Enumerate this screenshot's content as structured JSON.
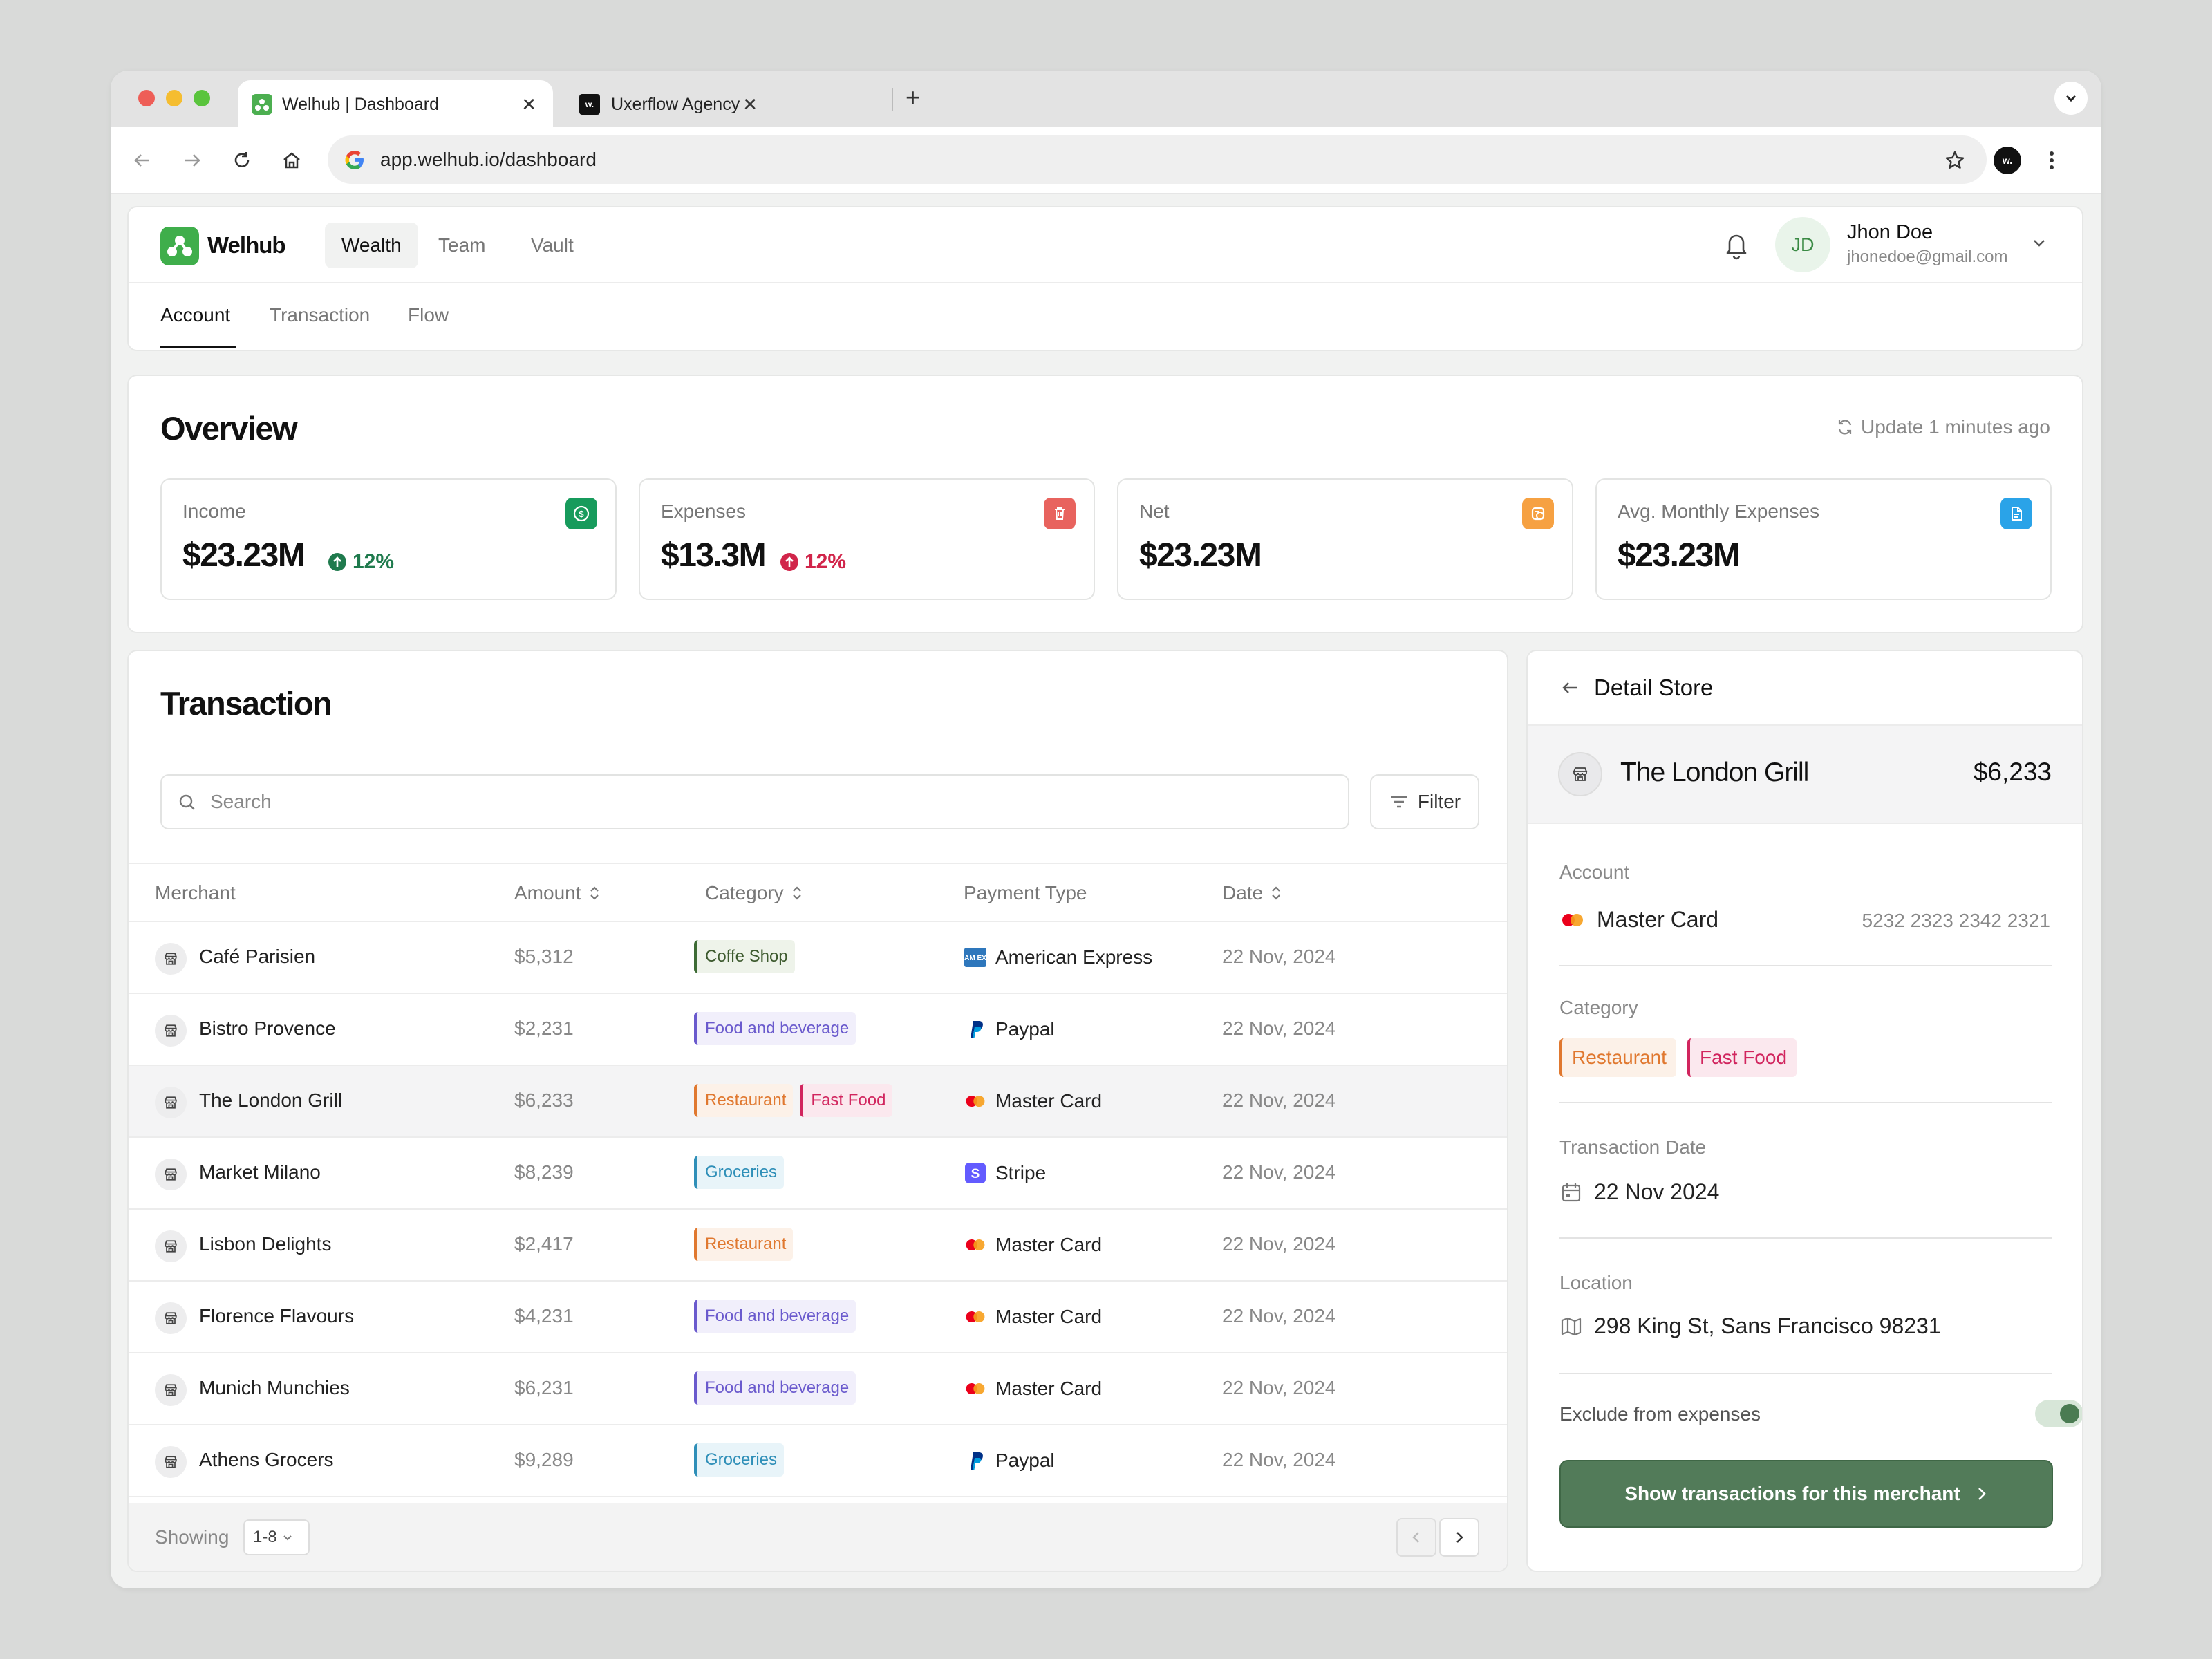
{
  "browser": {
    "tabs": [
      {
        "title": "Welhub | Dashboard",
        "close": "✕"
      },
      {
        "title": "Uxerflow Agency",
        "close": "✕"
      }
    ],
    "new_tab": "+",
    "url": "app.welhub.io/dashboard"
  },
  "app": {
    "brand": "Welhub",
    "nav": [
      "Wealth",
      "Team",
      "Vault"
    ],
    "subtabs": [
      "Account",
      "Transaction",
      "Flow"
    ],
    "user": {
      "initials": "JD",
      "name": "Jhon Doe",
      "email": "jhonedoe@gmail.com"
    }
  },
  "overview": {
    "title": "Overview",
    "updated": "Update 1 minutes ago",
    "stats": [
      {
        "label": "Income",
        "value": "$23.23M",
        "change": "12%",
        "color": "#1f7a4d",
        "icon": "dollar-icon"
      },
      {
        "label": "Expenses",
        "value": "$13.3M",
        "change": "12%",
        "color": "#d1254a",
        "icon": "trash-icon"
      },
      {
        "label": "Net",
        "value": "$23.23M",
        "icon": "coins-icon"
      },
      {
        "label": "Avg. Monthly Expenses",
        "value": "$23.23M",
        "icon": "file-icon"
      }
    ]
  },
  "transactions": {
    "title": "Transaction",
    "search_placeholder": "Search",
    "filter_label": "Filter",
    "columns": [
      "Merchant",
      "Amount",
      "Category",
      "Payment Type",
      "Date"
    ],
    "rows": [
      {
        "merchant": "Café Parisien",
        "amount": "$5,312",
        "categories": [
          "Coffe Shop"
        ],
        "payment": "American Express",
        "date": "22 Nov, 2024"
      },
      {
        "merchant": "Bistro Provence",
        "amount": "$2,231",
        "categories": [
          "Food and beverage"
        ],
        "payment": "Paypal",
        "date": "22 Nov, 2024"
      },
      {
        "merchant": "The London Grill",
        "amount": "$6,233",
        "categories": [
          "Restaurant",
          "Fast Food"
        ],
        "payment": "Master Card",
        "date": "22 Nov, 2024"
      },
      {
        "merchant": "Market Milano",
        "amount": "$8,239",
        "categories": [
          "Groceries"
        ],
        "payment": "Stripe",
        "date": "22 Nov, 2024"
      },
      {
        "merchant": "Lisbon Delights",
        "amount": "$2,417",
        "categories": [
          "Restaurant"
        ],
        "payment": "Master Card",
        "date": "22 Nov, 2024"
      },
      {
        "merchant": "Florence Flavours",
        "amount": "$4,231",
        "categories": [
          "Food and beverage"
        ],
        "payment": "Master Card",
        "date": "22 Nov, 2024"
      },
      {
        "merchant": "Munich Munchies",
        "amount": "$6,231",
        "categories": [
          "Food and beverage"
        ],
        "payment": "Master Card",
        "date": "22 Nov, 2024"
      },
      {
        "merchant": "Athens Grocers",
        "amount": "$9,289",
        "categories": [
          "Groceries"
        ],
        "payment": "Paypal",
        "date": "22 Nov, 2024"
      }
    ],
    "footer": {
      "showing_label": "Showing",
      "range": "1-8"
    }
  },
  "detail": {
    "title": "Detail Store",
    "store_name": "The London Grill",
    "store_amount": "$6,233",
    "account_label": "Account",
    "account_value": "Master Card",
    "card_number": "5232 2323 2342 2321",
    "category_label": "Category",
    "categories": [
      "Restaurant",
      "Fast Food"
    ],
    "date_label": "Transaction Date",
    "date_value": "22 Nov 2024",
    "location_label": "Location",
    "location_value": "298 King St, Sans Francisco 98231",
    "exclude_label": "Exclude from expenses",
    "exclude_on": true,
    "cta": "Show transactions for this merchant"
  },
  "tag_colors": {
    "Coffe Shop": {
      "fg": "#3d5a2e",
      "bg": "#eef3ea",
      "bar": "#3d6b35"
    },
    "Food and beverage": {
      "fg": "#6a5acd",
      "bg": "#f1effb",
      "bar": "#6a5acd"
    },
    "Restaurant": {
      "fg": "#e0782f",
      "bg": "#fcf1e8",
      "bar": "#e0782f"
    },
    "Fast Food": {
      "fg": "#d1255e",
      "bg": "#fbe8ee",
      "bar": "#d1255e"
    },
    "Groceries": {
      "fg": "#2f8fb8",
      "bg": "#e8f4f9",
      "bar": "#2f8fb8"
    }
  }
}
